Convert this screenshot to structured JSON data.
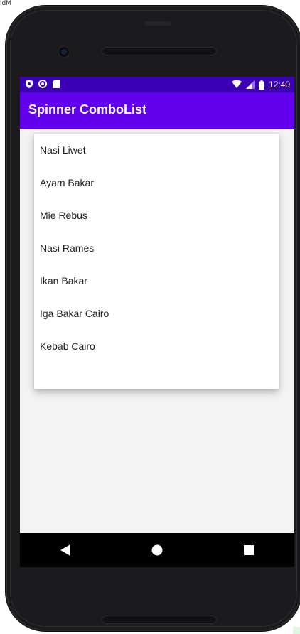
{
  "corner_label": "idM",
  "status_bar": {
    "time": "12:40",
    "left_icons": [
      "shield-icon",
      "circle-icon",
      "sd-card-icon"
    ],
    "right_icons": [
      "wifi-icon",
      "signal-icon",
      "battery-icon"
    ],
    "background": "#3b00b3"
  },
  "app_bar": {
    "title": "Spinner ComboList",
    "background": "#6200ee"
  },
  "dropdown": {
    "items": [
      "Nasi Liwet",
      "Ayam Bakar",
      "Mie Rebus",
      "Nasi Rames",
      "Ikan Bakar",
      "Iga Bakar Cairo",
      "Kebab Cairo"
    ]
  },
  "nav_bar": {
    "buttons": [
      "back-icon",
      "home-icon",
      "recents-icon"
    ]
  }
}
